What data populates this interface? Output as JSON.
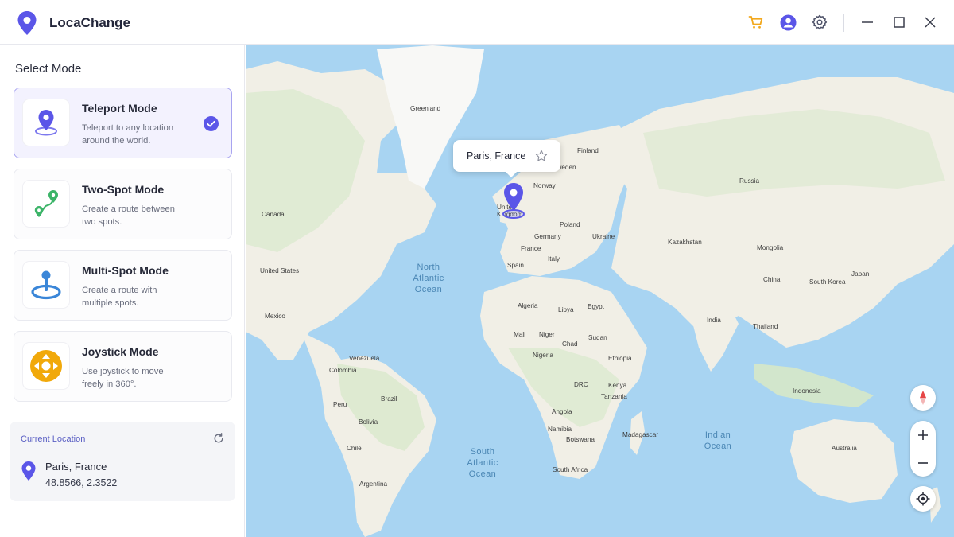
{
  "app": {
    "name": "LocaChange",
    "icons": [
      "location-pin-icon",
      "cart-icon",
      "account-icon",
      "gear-icon",
      "minimize-icon",
      "maximize-icon",
      "close-icon"
    ],
    "accent_color": "#5b56e8",
    "cart_color": "#f2a81d"
  },
  "sidebar": {
    "title": "Select Mode",
    "modes": [
      {
        "title": "Teleport Mode",
        "desc_line1": "Teleport to any location",
        "desc_line2": "around the world.",
        "icon": "teleport-pin-icon",
        "selected": true
      },
      {
        "title": "Two-Spot Mode",
        "desc_line1": "Create a route between",
        "desc_line2": "two spots.",
        "icon": "two-spot-route-icon",
        "selected": false
      },
      {
        "title": "Multi-Spot Mode",
        "desc_line1": "Create a route with",
        "desc_line2": "multiple spots.",
        "icon": "multi-spot-icon",
        "selected": false
      },
      {
        "title": "Joystick Mode",
        "desc_line1": "Use joystick to move",
        "desc_line2": "freely in 360°.",
        "icon": "joystick-icon",
        "selected": false
      }
    ],
    "current_location": {
      "label": "Current Location",
      "name": "Paris, France",
      "coords": "48.8566, 2.3522"
    }
  },
  "map": {
    "popup_text": "Paris, France",
    "labels": {
      "greenland": "Greenland",
      "canada": "Canada",
      "united_states": "United States",
      "mexico": "Mexico",
      "venezuela": "Venezuela",
      "colombia": "Colombia",
      "peru": "Peru",
      "brazil": "Brazil",
      "bolivia": "Bolivia",
      "chile": "Chile",
      "argentina": "Argentina",
      "finland": "Finland",
      "sweden": "Sweden",
      "norway": "Norway",
      "united_kingdom": "United Kingdom",
      "poland": "Poland",
      "germany": "Germany",
      "ukraine": "Ukraine",
      "france": "France",
      "spain": "Spain",
      "italy": "Italy",
      "russia": "Russia",
      "kazakhstan": "Kazakhstan",
      "mongolia": "Mongolia",
      "china": "China",
      "south_korea": "South Korea",
      "japan": "Japan",
      "india": "India",
      "thailand": "Thailand",
      "indonesia": "Indonesia",
      "australia": "Australia",
      "algeria": "Algeria",
      "libya": "Libya",
      "egypt": "Egypt",
      "mali": "Mali",
      "niger": "Niger",
      "chad": "Chad",
      "sudan": "Sudan",
      "nigeria": "Nigeria",
      "ethiopia": "Ethiopia",
      "drc": "DRC",
      "kenya": "Kenya",
      "tanzania": "Tanzania",
      "angola": "Angola",
      "namibia": "Namibia",
      "botswana": "Botswana",
      "madagascar": "Madagascar",
      "south_africa": "South Africa"
    },
    "oceans": {
      "north_atlantic_1": "North",
      "north_atlantic_2": "Atlantic",
      "north_atlantic_3": "Ocean",
      "south_atlantic_1": "South",
      "south_atlantic_2": "Atlantic",
      "south_atlantic_3": "Ocean",
      "indian_1": "Indian",
      "indian_2": "Ocean"
    },
    "controls": [
      "compass-icon",
      "zoom-in-icon",
      "zoom-out-icon",
      "my-location-icon"
    ],
    "land_color": "#f1efe6",
    "water_color": "#a8d4f2",
    "green_color": "#d6e8c8"
  }
}
